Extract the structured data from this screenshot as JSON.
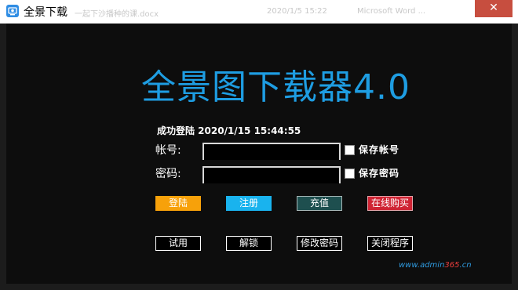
{
  "window": {
    "title": "全景下载",
    "close_symbol": "✕",
    "background_ghost": [
      "一起下沙播种的课.docx",
      "2020/1/5 15:22",
      "Microsoft Word ..."
    ]
  },
  "app": {
    "title": "全景图下载器4.0",
    "status": "成功登陆 2020/1/15 15:44:55"
  },
  "form": {
    "account_label": "帐号:",
    "account_value": "",
    "password_label": "密码:",
    "password_value": "",
    "save_account_label": "保存帐号",
    "save_password_label": "保存密码"
  },
  "buttons": {
    "login": "登陆",
    "register": "注册",
    "recharge": "充值",
    "buy_online": "在线购买",
    "trial": "试用",
    "unlock": "解锁",
    "change_password": "修改密码",
    "close_program": "关闭程序"
  },
  "watermark": {
    "prefix": "www.admin",
    "accent": "365",
    "suffix": ".cn"
  },
  "colors": {
    "title_blue": "#1e9de2",
    "login_orange": "#f7a10a",
    "register_blue": "#19b3ee",
    "recharge_teal": "#1e4f4f",
    "buy_red": "#cf2434",
    "close_red": "#c74e3f"
  },
  "icons": {
    "app_icon": "panorama-camera-icon",
    "close_icon": "close-x-icon"
  }
}
